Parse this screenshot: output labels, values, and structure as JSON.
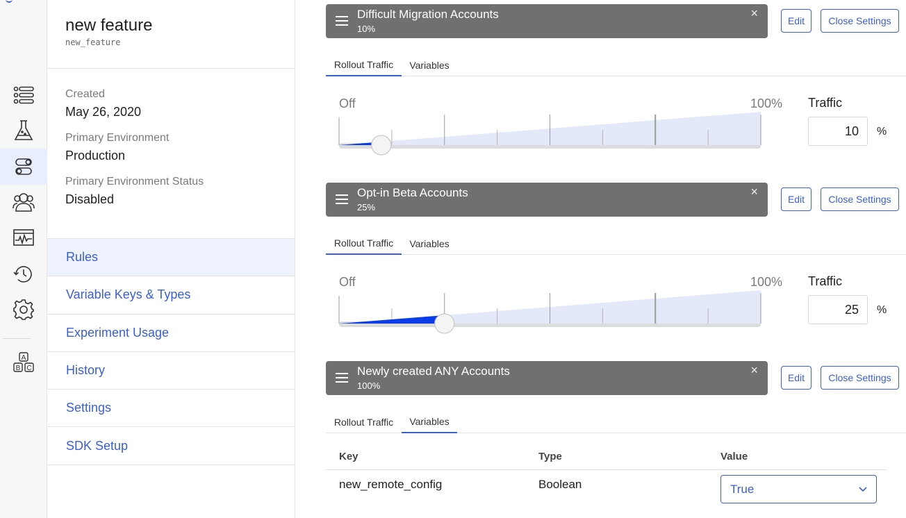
{
  "colors": {
    "accent": "#3a5fd0",
    "rule_bar": "#707070",
    "slider_fill": "#0a3de8",
    "slider_track": "#e4e9fa"
  },
  "rail": {
    "items": [
      {
        "icon": "list-icon",
        "active": false
      },
      {
        "icon": "flask-icon",
        "active": false
      },
      {
        "icon": "toggle-icon",
        "active": true
      },
      {
        "icon": "users-icon",
        "active": false
      },
      {
        "icon": "monitor-pulse-icon",
        "active": false
      },
      {
        "icon": "history-icon",
        "active": false
      },
      {
        "icon": "gear-icon",
        "active": false
      },
      {
        "icon": "abc-icon",
        "active": false
      }
    ]
  },
  "feature": {
    "name": "new feature",
    "key": "new_feature",
    "created_label": "Created",
    "created_value": "May 26, 2020",
    "env_label": "Primary Environment",
    "env_value": "Production",
    "status_label": "Primary Environment Status",
    "status_value": "Disabled"
  },
  "nav": [
    {
      "label": "Rules",
      "active": true
    },
    {
      "label": "Variable Keys & Types",
      "active": false
    },
    {
      "label": "Experiment Usage",
      "active": false
    },
    {
      "label": "History",
      "active": false
    },
    {
      "label": "Settings",
      "active": false
    },
    {
      "label": "SDK Setup",
      "active": false
    }
  ],
  "common": {
    "edit_label": "Edit",
    "close_settings_label": "Close Settings",
    "tab_rollout": "Rollout Traffic",
    "tab_variables": "Variables",
    "slider_off": "Off",
    "slider_max": "100%",
    "traffic_label": "Traffic",
    "percent_unit": "%",
    "close_x": "×"
  },
  "rules": [
    {
      "title": "Difficult Migration Accounts",
      "percent_text": "10%",
      "traffic": 10,
      "active_tab": "rollout"
    },
    {
      "title": "Opt-in Beta Accounts",
      "percent_text": "25%",
      "traffic": 25,
      "active_tab": "rollout"
    },
    {
      "title": "Newly created ANY Accounts",
      "percent_text": "100%",
      "traffic": 100,
      "active_tab": "variables",
      "variables": {
        "headers": {
          "key": "Key",
          "type": "Type",
          "value": "Value"
        },
        "rows": [
          {
            "key": "new_remote_config",
            "type": "Boolean",
            "value": "True"
          }
        ]
      }
    }
  ]
}
